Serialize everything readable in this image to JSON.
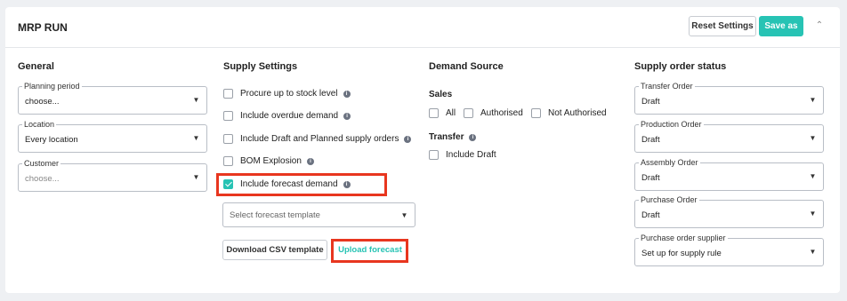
{
  "header": {
    "title": "MRP RUN",
    "reset_label": "Reset Settings",
    "save_label": "Save as"
  },
  "general": {
    "title": "General",
    "fields": [
      {
        "label": "Planning period",
        "value": "choose...",
        "placeholder": true
      },
      {
        "label": "Location",
        "value": "Every location",
        "placeholder": false
      },
      {
        "label": "Customer",
        "value": "choose...",
        "placeholder": true
      }
    ]
  },
  "supply_settings": {
    "title": "Supply Settings",
    "options": [
      {
        "label": "Procure up to stock level",
        "checked": false,
        "info": true
      },
      {
        "label": "Include overdue demand",
        "checked": false,
        "info": true
      },
      {
        "label": "Include Draft and Planned supply orders",
        "checked": false,
        "info": true
      },
      {
        "label": "BOM Explosion",
        "checked": false,
        "info": true
      },
      {
        "label": "Include forecast demand",
        "checked": true,
        "info": true
      }
    ],
    "forecast_template_placeholder": "Select forecast template",
    "download_csv_label": "Download CSV template",
    "upload_label": "Upload forecast"
  },
  "demand_source": {
    "title": "Demand Source",
    "sales_title": "Sales",
    "sales_options": [
      {
        "label": "All",
        "checked": false
      },
      {
        "label": "Authorised",
        "checked": false
      },
      {
        "label": "Not Authorised",
        "checked": false
      }
    ],
    "transfer_title": "Transfer",
    "transfer_options": [
      {
        "label": "Include Draft",
        "checked": false
      }
    ]
  },
  "supply_order_status": {
    "title": "Supply order status",
    "fields": [
      {
        "label": "Transfer Order",
        "value": "Draft"
      },
      {
        "label": "Production Order",
        "value": "Draft"
      },
      {
        "label": "Assembly Order",
        "value": "Draft"
      },
      {
        "label": "Purchase Order",
        "value": "Draft"
      },
      {
        "label": "Purchase order supplier",
        "value": "Set up for supply rule"
      }
    ]
  },
  "colors": {
    "accent": "#27c3b4",
    "highlight": "#e8361f",
    "background": "#eef0f3"
  },
  "icons": [
    "info-icon",
    "chevron-down-icon",
    "chevron-up-icon",
    "checkmark-icon"
  ]
}
